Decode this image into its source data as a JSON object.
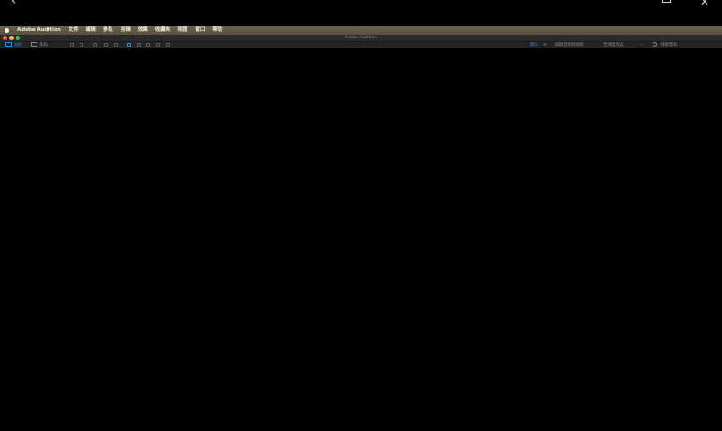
{
  "viewer": {
    "back_glyph": "‹",
    "close_glyph": "✕"
  },
  "menubar": {
    "app_name": "Adobe Audition",
    "items": [
      "文件",
      "编辑",
      "多轨",
      "剪辑",
      "效果",
      "收藏夹",
      "视图",
      "窗口",
      "帮助"
    ]
  },
  "window": {
    "title": "Adobe Audition",
    "traffic_lights": {
      "close": "#fe5f57",
      "minimize": "#febc2e",
      "zoom": "#28c840"
    }
  },
  "toolbar": {
    "waveform_label": "波形",
    "multitrack_label": "多轨",
    "workspace_default": "默认",
    "workspace_menu": "≡",
    "workspace_edit": "编辑音频到视频",
    "workspace_radio": "无线电作品",
    "more": "»",
    "search_label": "搜索帮助"
  },
  "colors": {
    "accent": "#2f8ee6",
    "menubar": "#5f5747",
    "background": "#000000"
  }
}
